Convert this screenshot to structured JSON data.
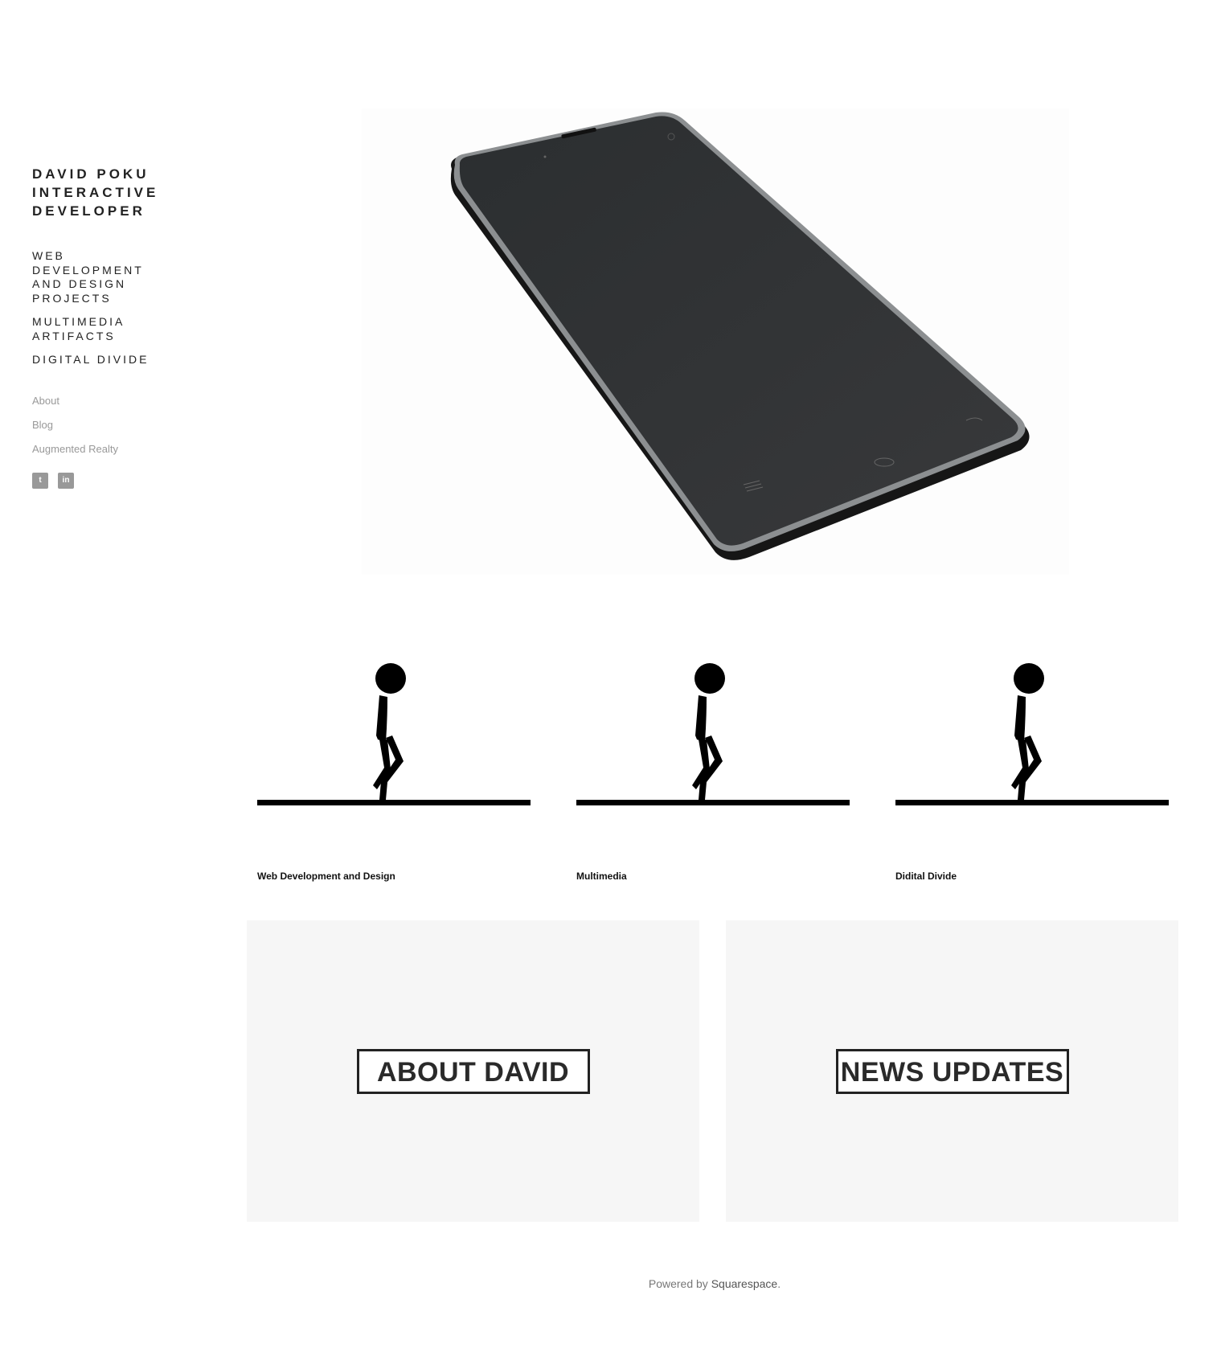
{
  "site": {
    "title": "DAVID POKU\nINTERACTIVE\nDEVELOPER"
  },
  "main_nav": [
    {
      "label": "WEB DEVELOPMENT AND DESIGN PROJECTS"
    },
    {
      "label": "MULTIMEDIA ARTIFACTS"
    },
    {
      "label": "DIGITAL DIVIDE"
    }
  ],
  "secondary_nav": [
    {
      "label": "About"
    },
    {
      "label": "Blog"
    },
    {
      "label": "Augmented Realty"
    }
  ],
  "social": [
    {
      "icon": "twitter-icon",
      "glyph": "t"
    },
    {
      "icon": "linkedin-icon",
      "glyph": "in"
    }
  ],
  "tiles": [
    {
      "label": "Web Development and Design"
    },
    {
      "label": "Multimedia"
    },
    {
      "label": "Didital Divide"
    }
  ],
  "banners": [
    {
      "label": "ABOUT DAVID"
    },
    {
      "label": "NEWS UPDATES"
    }
  ],
  "footer": {
    "prefix": "Powered by ",
    "link": "Squarespace",
    "suffix": "."
  },
  "colors": {
    "text": "#222222",
    "muted": "#999999",
    "banner_bg": "#f6f6f6"
  }
}
